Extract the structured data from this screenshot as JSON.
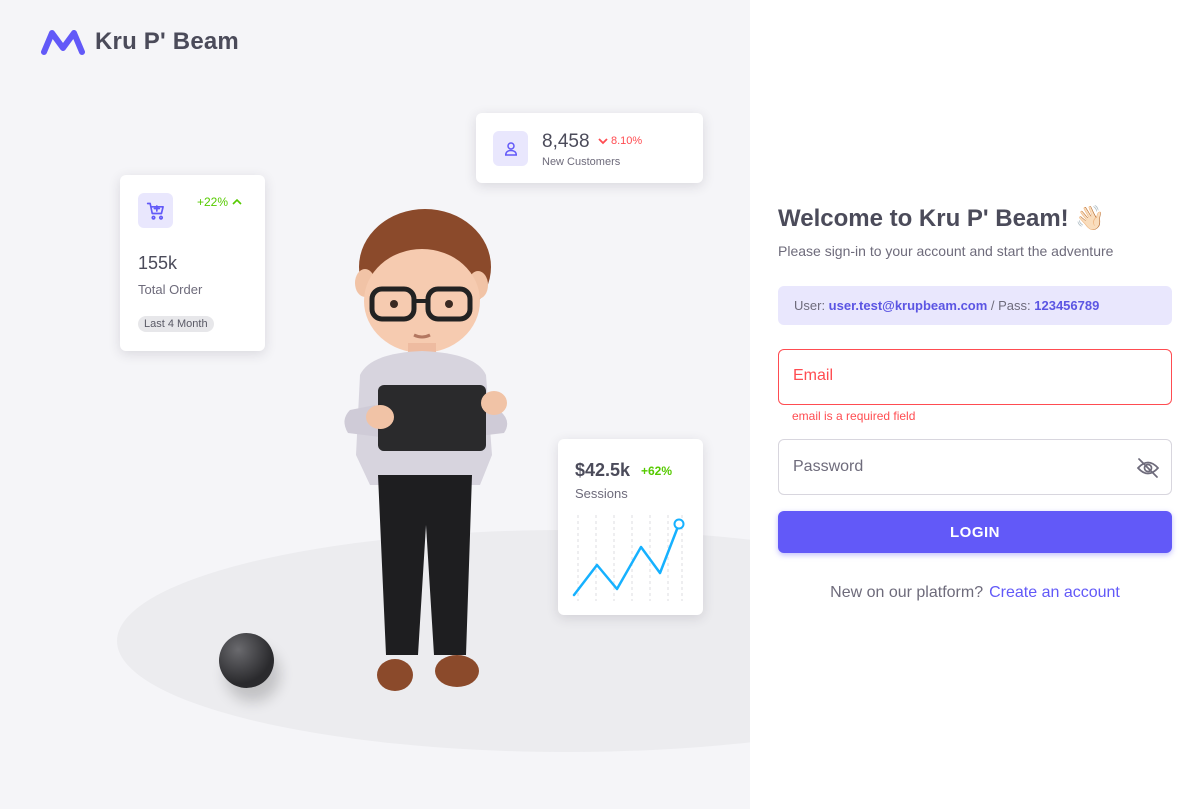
{
  "brand": {
    "name": "Kru P' Beam",
    "logo_icon": "brand-logo-icon",
    "color": "#6259f8"
  },
  "stats": {
    "orders": {
      "trend": "+22%",
      "value": "155k",
      "label": "Total Order",
      "period": "Last 4 Month",
      "icon": "cart-plus-icon"
    },
    "customers": {
      "value": "8,458",
      "trend": "8.10%",
      "label": "New Customers",
      "icon": "user-icon"
    },
    "sessions": {
      "value": "$42.5k",
      "trend": "+62%",
      "label": "Sessions"
    }
  },
  "login": {
    "title": "Welcome to Kru P' Beam! 👋🏻",
    "subtitle": "Please sign-in to your account and start the adventure",
    "cred_user_label": "User: ",
    "cred_user": "user.test@krupbeam.com",
    "cred_sep": " / Pass: ",
    "cred_pass": "123456789",
    "email_placeholder": "Email",
    "email_error": "email is a required field",
    "password_placeholder": "Password",
    "login_label": "LOGIN",
    "signup_text": "New on our platform?",
    "signup_link": "Create an account"
  },
  "colors": {
    "primary": "#6259f8",
    "success": "#56ca00",
    "error": "#ff4c51"
  }
}
